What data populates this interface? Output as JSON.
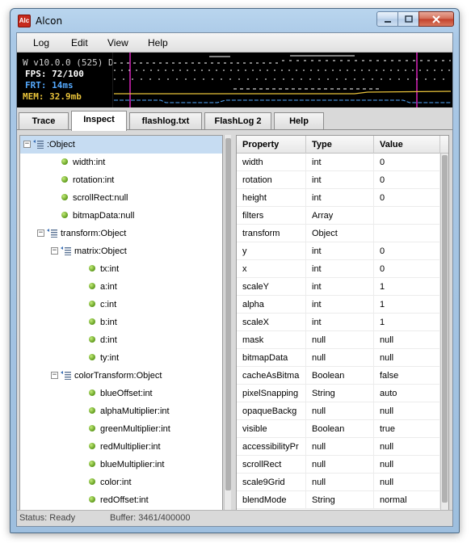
{
  "window": {
    "title": "Alcon",
    "icon_text": "Alc"
  },
  "menu": [
    "Log",
    "Edit",
    "View",
    "Help"
  ],
  "monitor": {
    "version": "W v10.0.0 (525) D",
    "fps": "FPS: 72/100",
    "frt": "FRT: 14ms",
    "mem": "MEM: 32.9mb",
    "colors": {
      "fps": "#ffffff",
      "frt": "#55aaff",
      "mem": "#e8c23a",
      "marker": "#a31a8c"
    }
  },
  "tabs": [
    "Trace",
    "Inspect",
    "flashlog.txt",
    "FlashLog 2",
    "Help"
  ],
  "active_tab": "Inspect",
  "tree": [
    {
      "label": ":Object",
      "type": "object",
      "expander": "−"
    },
    {
      "label": "width:int",
      "type": "leaf"
    },
    {
      "label": "rotation:int",
      "type": "leaf"
    },
    {
      "label": "scrollRect:null",
      "type": "leaf"
    },
    {
      "label": "bitmapData:null",
      "type": "leaf"
    },
    {
      "label": "transform:Object",
      "type": "object",
      "expander": "−"
    },
    {
      "label": "matrix:Object",
      "type": "object",
      "expander": "−"
    },
    {
      "label": "tx:int",
      "type": "leaf"
    },
    {
      "label": "a:int",
      "type": "leaf"
    },
    {
      "label": "c:int",
      "type": "leaf"
    },
    {
      "label": "b:int",
      "type": "leaf"
    },
    {
      "label": "d:int",
      "type": "leaf"
    },
    {
      "label": "ty:int",
      "type": "leaf"
    },
    {
      "label": "colorTransform:Object",
      "type": "object",
      "expander": "−"
    },
    {
      "label": "blueOffset:int",
      "type": "leaf"
    },
    {
      "label": "alphaMultiplier:int",
      "type": "leaf"
    },
    {
      "label": "greenMultiplier:int",
      "type": "leaf"
    },
    {
      "label": "redMultiplier:int",
      "type": "leaf"
    },
    {
      "label": "blueMultiplier:int",
      "type": "leaf"
    },
    {
      "label": "color:int",
      "type": "leaf"
    },
    {
      "label": "redOffset:int",
      "type": "leaf"
    }
  ],
  "grid": {
    "headers": [
      "Property",
      "Type",
      "Value"
    ],
    "rows": [
      [
        "width",
        "int",
        "0"
      ],
      [
        "rotation",
        "int",
        "0"
      ],
      [
        "height",
        "int",
        "0"
      ],
      [
        "filters",
        "Array",
        ""
      ],
      [
        "transform",
        "Object",
        ""
      ],
      [
        "y",
        "int",
        "0"
      ],
      [
        "x",
        "int",
        "0"
      ],
      [
        "scaleY",
        "int",
        "1"
      ],
      [
        "alpha",
        "int",
        "1"
      ],
      [
        "scaleX",
        "int",
        "1"
      ],
      [
        "mask",
        "null",
        "null"
      ],
      [
        "bitmapData",
        "null",
        "null"
      ],
      [
        "cacheAsBitma",
        "Boolean",
        "false"
      ],
      [
        "pixelSnapping",
        "String",
        "auto"
      ],
      [
        "opaqueBackg",
        "null",
        "null"
      ],
      [
        "visible",
        "Boolean",
        "true"
      ],
      [
        "accessibilityPr",
        "null",
        "null"
      ],
      [
        "scrollRect",
        "null",
        "null"
      ],
      [
        "scale9Grid",
        "null",
        "null"
      ],
      [
        "blendMode",
        "String",
        "normal"
      ]
    ]
  },
  "status": {
    "text": "Status: Ready",
    "buffer": "Buffer: 3461/400000"
  }
}
